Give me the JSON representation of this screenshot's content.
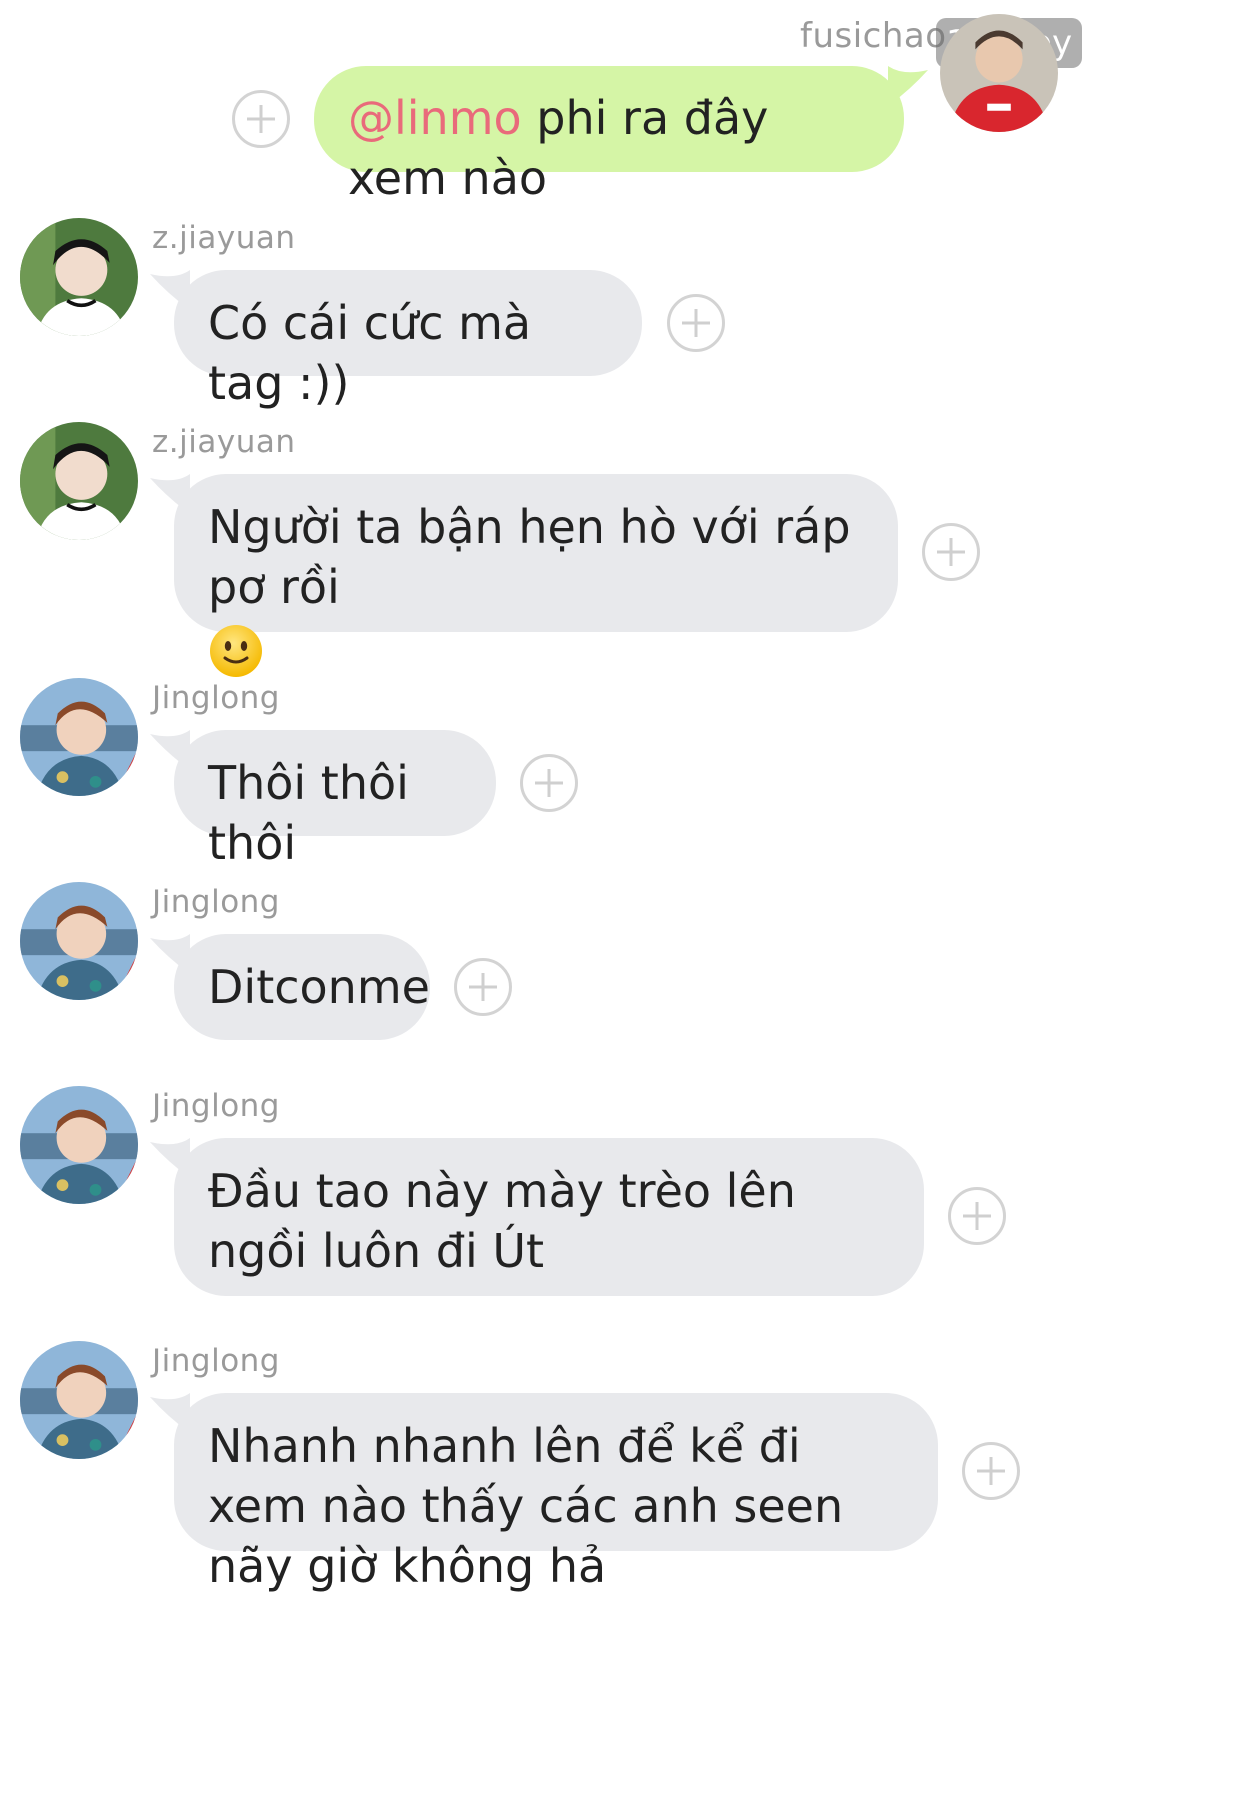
{
  "self_message": {
    "sender": "fusichao",
    "badge": "100 joy",
    "mention": "@linmo",
    "text": " phi ra đây xem nào"
  },
  "messages": [
    {
      "sender": "z.jiayuan",
      "avatar": "avatar-zjiayuan",
      "text": "Có cái cức mà tag :))"
    },
    {
      "sender": "z.jiayuan",
      "avatar": "avatar-zjiayuan",
      "text": "Người ta bận hẹn hò với ráp pơ rồi",
      "emoji": "slightly-smiling-face"
    },
    {
      "sender": "Jinglong",
      "avatar": "avatar-jinglong",
      "text": "Thôi thôi thôi"
    },
    {
      "sender": "Jinglong",
      "avatar": "avatar-jinglong",
      "text": "Ditconme"
    },
    {
      "sender": "Jinglong",
      "avatar": "avatar-jinglong",
      "text": "Đầu tao này mày trèo lên ngồi luôn đi Út"
    },
    {
      "sender": "Jinglong",
      "avatar": "avatar-jinglong",
      "text": "Nhanh nhanh lên để kể đi xem nào thấy các anh seen nãy giờ không hả"
    }
  ],
  "colors": {
    "incoming_bubble": "#e8e9ec",
    "outgoing_bubble": "#d5f5a6",
    "mention": "#e96a7b",
    "sender_name": "#9a9a9a"
  }
}
